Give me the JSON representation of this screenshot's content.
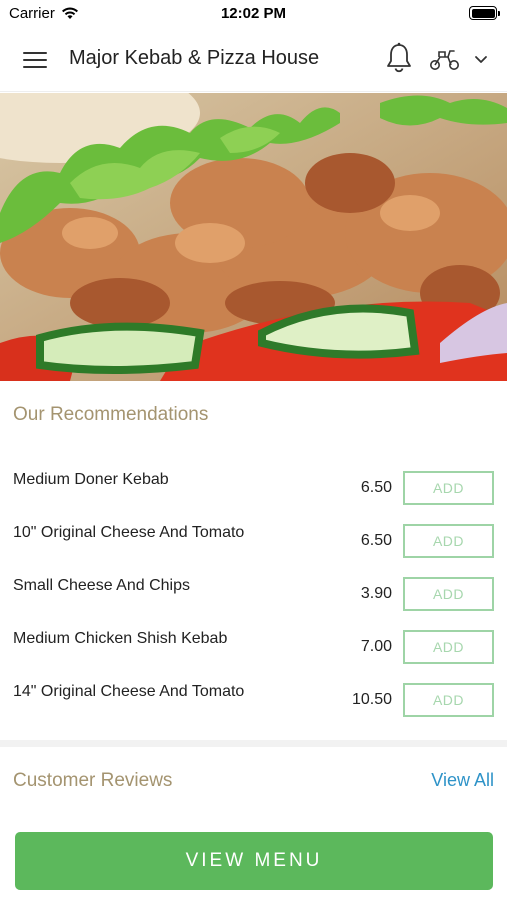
{
  "status_bar": {
    "carrier": "Carrier",
    "time": "12:02 PM"
  },
  "header": {
    "title": "Major Kebab & Pizza House"
  },
  "icons": {
    "menu": "hamburger-icon",
    "notifications": "bell-icon",
    "delivery": "scooter-icon",
    "dropdown": "chevron-down-icon"
  },
  "recommendations": {
    "title": "Our Recommendations",
    "add_label": "ADD",
    "items": [
      {
        "name": "Medium Doner Kebab",
        "price": "6.50"
      },
      {
        "name": "10\" Original Cheese And Tomato",
        "price": "6.50"
      },
      {
        "name": "Small Cheese And Chips",
        "price": "3.90"
      },
      {
        "name": "Medium Chicken Shish Kebab",
        "price": "7.00"
      },
      {
        "name": "14\" Original Cheese And Tomato",
        "price": "10.50"
      }
    ]
  },
  "reviews": {
    "title": "Customer Reviews",
    "view_all": "View All"
  },
  "footer": {
    "button_label": "VIEW MENU"
  },
  "colors": {
    "accent_green": "#5cb85c",
    "add_border": "#9ed4a6",
    "section_title": "#a49470",
    "link_blue": "#2e93c8"
  }
}
